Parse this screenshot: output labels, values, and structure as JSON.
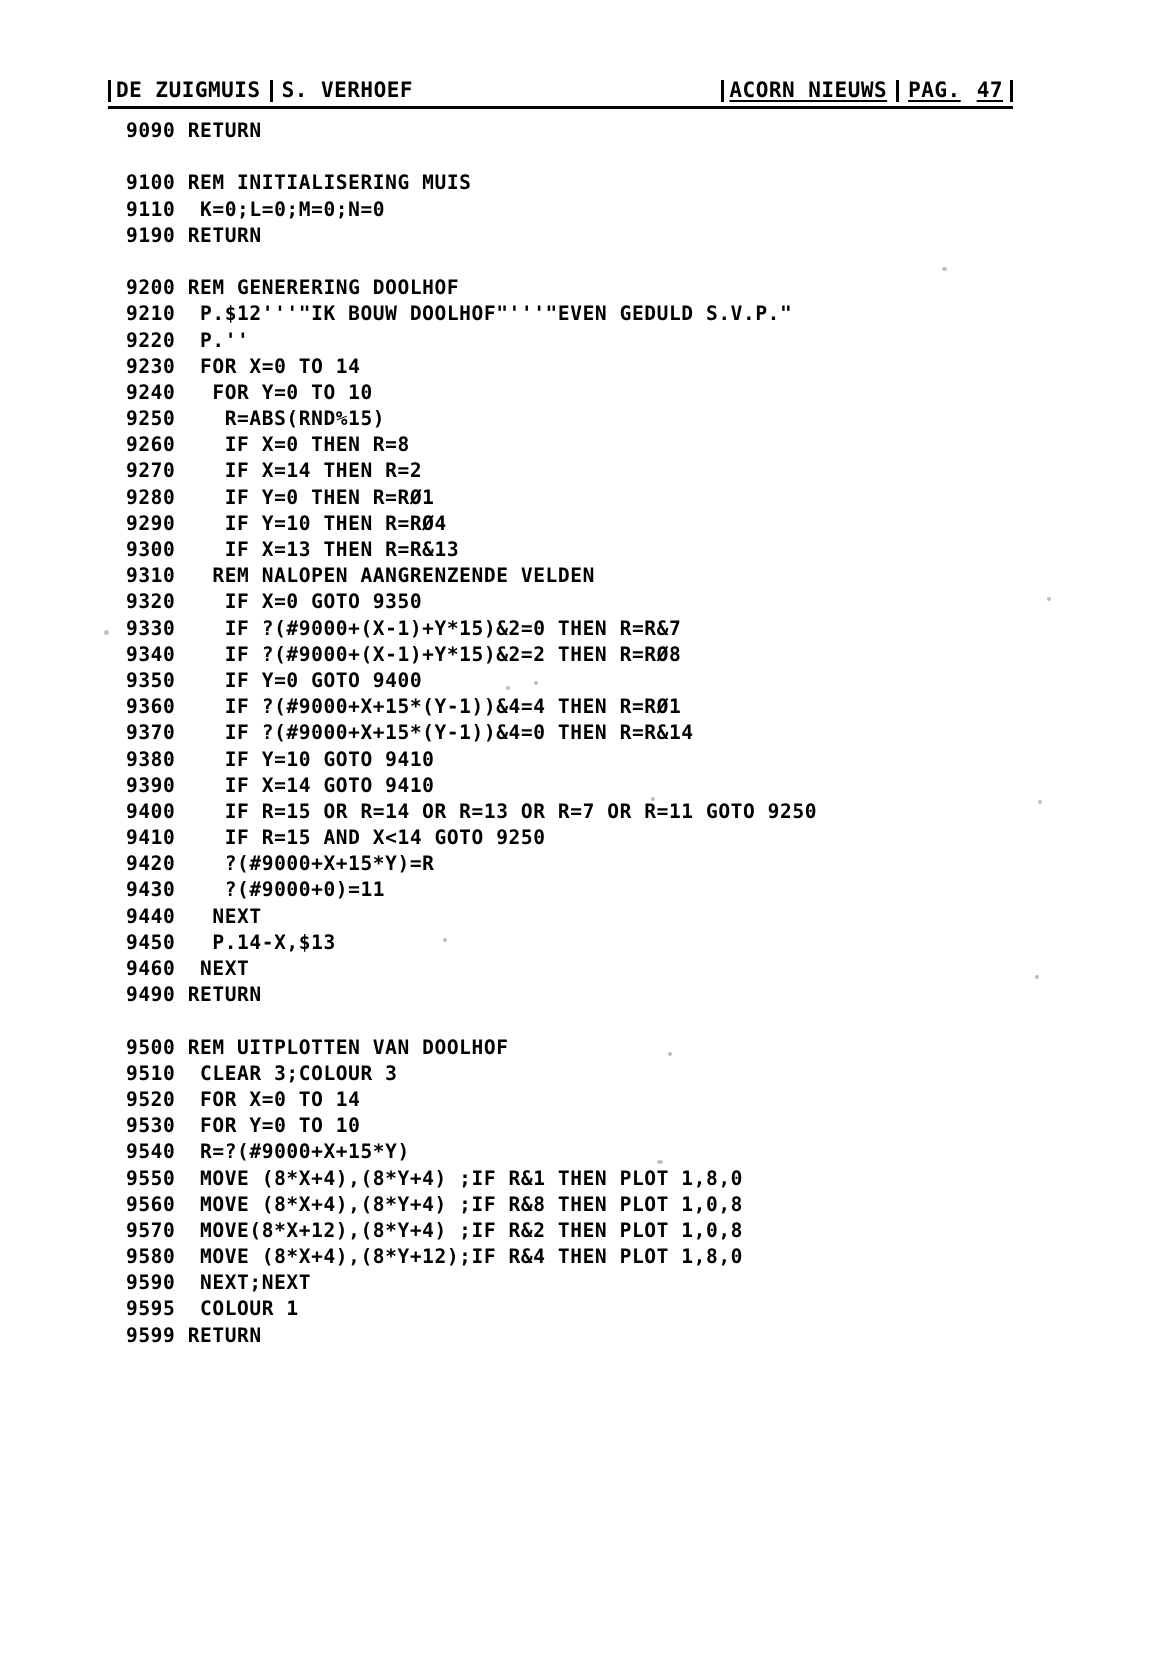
{
  "header": {
    "publication_left": "DE ZUIGMUIS",
    "author": "S. VERHOEF",
    "publication_right": "ACORN NIEUWS",
    "page_label": "PAG.",
    "page_number": "47"
  },
  "listing": {
    "language": "BBC BASIC",
    "lines": [
      "9090 RETURN",
      "",
      "9100 REM INITIALISERING MUIS",
      "9110  K=0;L=0;M=0;N=0",
      "9190 RETURN",
      "",
      "9200 REM GENERERING DOOLHOF",
      "9210  P.$12'''\"IK BOUW DOOLHOF\"'''\"EVEN GEDULD S.V.P.\"",
      "9220  P.''",
      "9230  FOR X=0 TO 14",
      "9240   FOR Y=0 TO 10",
      "9250    R=ABS(RND%15)",
      "9260    IF X=0 THEN R=8",
      "9270    IF X=14 THEN R=2",
      "9280    IF Y=0 THEN R=RØ1",
      "9290    IF Y=10 THEN R=RØ4",
      "9300    IF X=13 THEN R=R&13",
      "9310   REM NALOPEN AANGRENZENDE VELDEN",
      "9320    IF X=0 GOTO 9350",
      "9330    IF ?(#9000+(X-1)+Y*15)&2=0 THEN R=R&7",
      "9340    IF ?(#9000+(X-1)+Y*15)&2=2 THEN R=RØ8",
      "9350    IF Y=0 GOTO 9400",
      "9360    IF ?(#9000+X+15*(Y-1))&4=4 THEN R=RØ1",
      "9370    IF ?(#9000+X+15*(Y-1))&4=0 THEN R=R&14",
      "9380    IF Y=10 GOTO 9410",
      "9390    IF X=14 GOTO 9410",
      "9400    IF R=15 OR R=14 OR R=13 OR R=7 OR R=11 GOTO 9250",
      "9410    IF R=15 AND X<14 GOTO 9250",
      "9420    ?(#9000+X+15*Y)=R",
      "9430    ?(#9000+0)=11",
      "9440   NEXT",
      "9450   P.14-X,$13",
      "9460  NEXT",
      "9490 RETURN",
      "",
      "9500 REM UITPLOTTEN VAN DOOLHOF",
      "9510  CLEAR 3;COLOUR 3",
      "9520  FOR X=0 TO 14",
      "9530  FOR Y=0 TO 10",
      "9540  R=?(#9000+X+15*Y)",
      "9550  MOVE (8*X+4),(8*Y+4) ;IF R&1 THEN PLOT 1,8,0",
      "9560  MOVE (8*X+4),(8*Y+4) ;IF R&8 THEN PLOT 1,0,8",
      "9570  MOVE(8*X+12),(8*Y+4) ;IF R&2 THEN PLOT 1,0,8",
      "9580  MOVE (8*X+4),(8*Y+12);IF R&4 THEN PLOT 1,8,0",
      "9590  NEXT;NEXT",
      "9595  COLOUR 1",
      "9599 RETURN"
    ]
  }
}
